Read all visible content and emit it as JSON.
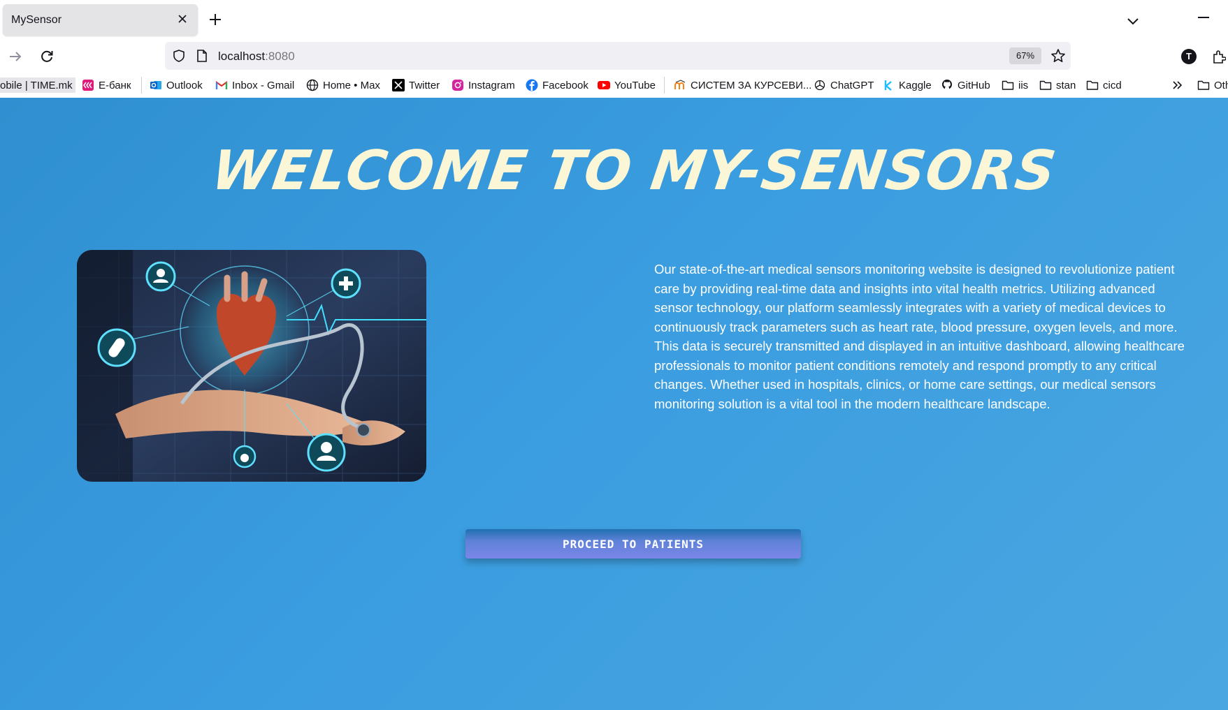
{
  "browser": {
    "tab_title": "MySensor",
    "url_host": "localhost",
    "url_port": ":8080",
    "zoom": "67%",
    "profile_initial": "T"
  },
  "bookmarks": [
    {
      "label": "obile | TIME.mk",
      "icon": "none"
    },
    {
      "label": "Е-банк",
      "icon": "ebank-icon",
      "color": "#e0187a"
    },
    {
      "label": "Outlook",
      "icon": "outlook-icon",
      "color": "#0a64c8"
    },
    {
      "label": "Inbox - Gmail",
      "icon": "gmail-icon",
      "color": "#d93025"
    },
    {
      "label": "Home • Max",
      "icon": "globe-icon",
      "color": "#15141a"
    },
    {
      "label": "Twitter",
      "icon": "x-icon",
      "color": "#000000"
    },
    {
      "label": "Instagram",
      "icon": "instagram-icon",
      "color": "#d6249f"
    },
    {
      "label": "Facebook",
      "icon": "facebook-icon",
      "color": "#1877f2"
    },
    {
      "label": "YouTube",
      "icon": "youtube-icon",
      "color": "#ff0000"
    },
    {
      "label": "СИСТЕМ ЗА КУРСЕВИ...",
      "icon": "moodle-icon",
      "color": "#f98012"
    },
    {
      "label": "ChatGPT",
      "icon": "chatgpt-icon",
      "color": "#15141a"
    },
    {
      "label": "Kaggle",
      "icon": "kaggle-icon",
      "color": "#20beff"
    },
    {
      "label": "GitHub",
      "icon": "github-icon",
      "color": "#15141a"
    },
    {
      "label": "iis",
      "icon": "folder-icon"
    },
    {
      "label": "stan",
      "icon": "folder-icon"
    },
    {
      "label": "cicd",
      "icon": "folder-icon"
    },
    {
      "label": "Oth",
      "icon": "folder-icon"
    }
  ],
  "page": {
    "title": "WELCOME TO MY-SENSORS",
    "description": "Our state-of-the-art medical sensors monitoring website is designed to revolutionize patient care by providing real-time data and insights into vital health metrics. Utilizing advanced sensor technology, our platform seamlessly integrates with a variety of medical devices to continuously track parameters such as heart rate, blood pressure, oxygen levels, and more. This data is securely transmitted and displayed in an intuitive dashboard, allowing healthcare professionals to monitor patient conditions remotely and respond promptly to any critical changes. Whether used in hospitals, clinics, or home care settings, our medical sensors monitoring solution is a vital tool in the modern healthcare landscape.",
    "proceed_label": "PROCEED TO PATIENTS"
  },
  "colors": {
    "page_background": "#3a9de0",
    "title_color": "#fbf6d6",
    "button_gradient_start": "#1f6fb0",
    "button_gradient_end": "#7b86e8"
  }
}
